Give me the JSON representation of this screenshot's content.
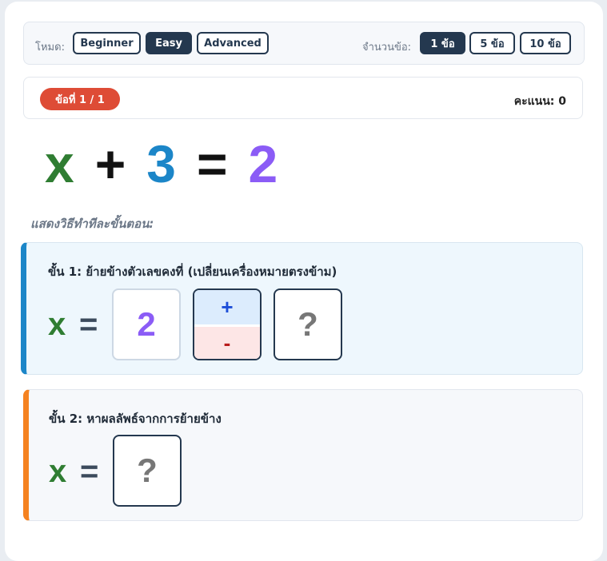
{
  "toolbar": {
    "mode_label": "โหมด:",
    "modes": [
      "Beginner",
      "Easy",
      "Advanced"
    ],
    "active_mode": "Easy",
    "count_label": "จำนวนข้อ:",
    "counts": [
      "1 ข้อ",
      "5 ข้อ",
      "10 ข้อ"
    ],
    "active_count": "1 ข้อ"
  },
  "status": {
    "question_badge": "ข้อที่ 1 / 1",
    "score": "คะแนน: 0"
  },
  "equation": {
    "variable": "x",
    "plus": "+",
    "constant": "3",
    "equals": "=",
    "result": "2"
  },
  "hint": "แสดงวิธีทำทีละขั้นตอน:",
  "step1": {
    "title": "ขั้น 1: ย้ายข้างตัวเลขคงที่ (เปลี่ยนเครื่องหมายตรงข้าม)",
    "variable": "x",
    "equals": "=",
    "value": "2",
    "sign_plus": "+",
    "sign_minus": "-",
    "answer_placeholder": "?"
  },
  "step2": {
    "title": "ขั้น 2: หาผลลัพธ์จากการย้ายข้าง",
    "variable": "x",
    "equals": "=",
    "answer_placeholder": "?"
  },
  "colors": {
    "primary": "#24384f",
    "variable": "#2f7d32",
    "constant": "#1c86c8",
    "result": "#8b5cf6",
    "badge": "#de4c36",
    "step1_accent": "#1c86c8",
    "step2_accent": "#f58220"
  }
}
